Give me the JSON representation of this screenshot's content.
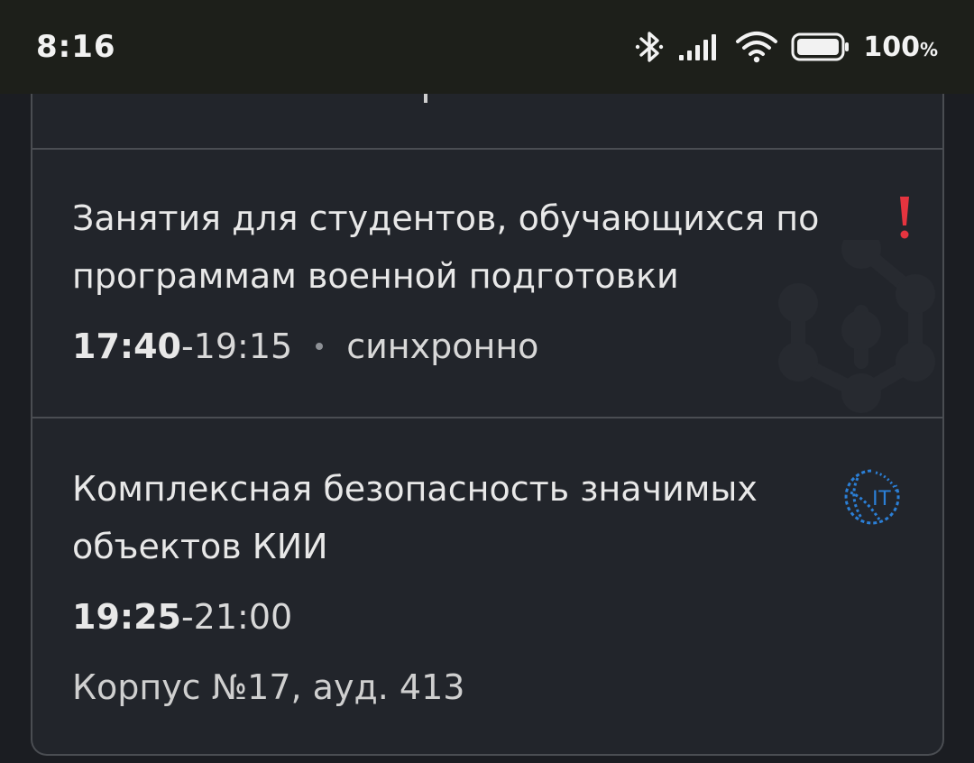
{
  "status_bar": {
    "time": "8:16",
    "battery_percent": "100",
    "battery_unit": "%"
  },
  "schedule": [
    {
      "title": "Занятия для студентов, обучающихся по программам военной подготовки",
      "time_start": "17:40",
      "time_end": "-19:15",
      "mode": "синхронно",
      "badge_icon": "exclamation-icon",
      "badge_color": "#e5343f"
    },
    {
      "title": "Комплексная безопасность значимых объектов КИИ",
      "time_start": "19:25",
      "time_end": "-21:00",
      "location": "Корпус №17, ауд. 413",
      "logo_text": "IT",
      "logo_color": "#2b7fd6"
    }
  ]
}
